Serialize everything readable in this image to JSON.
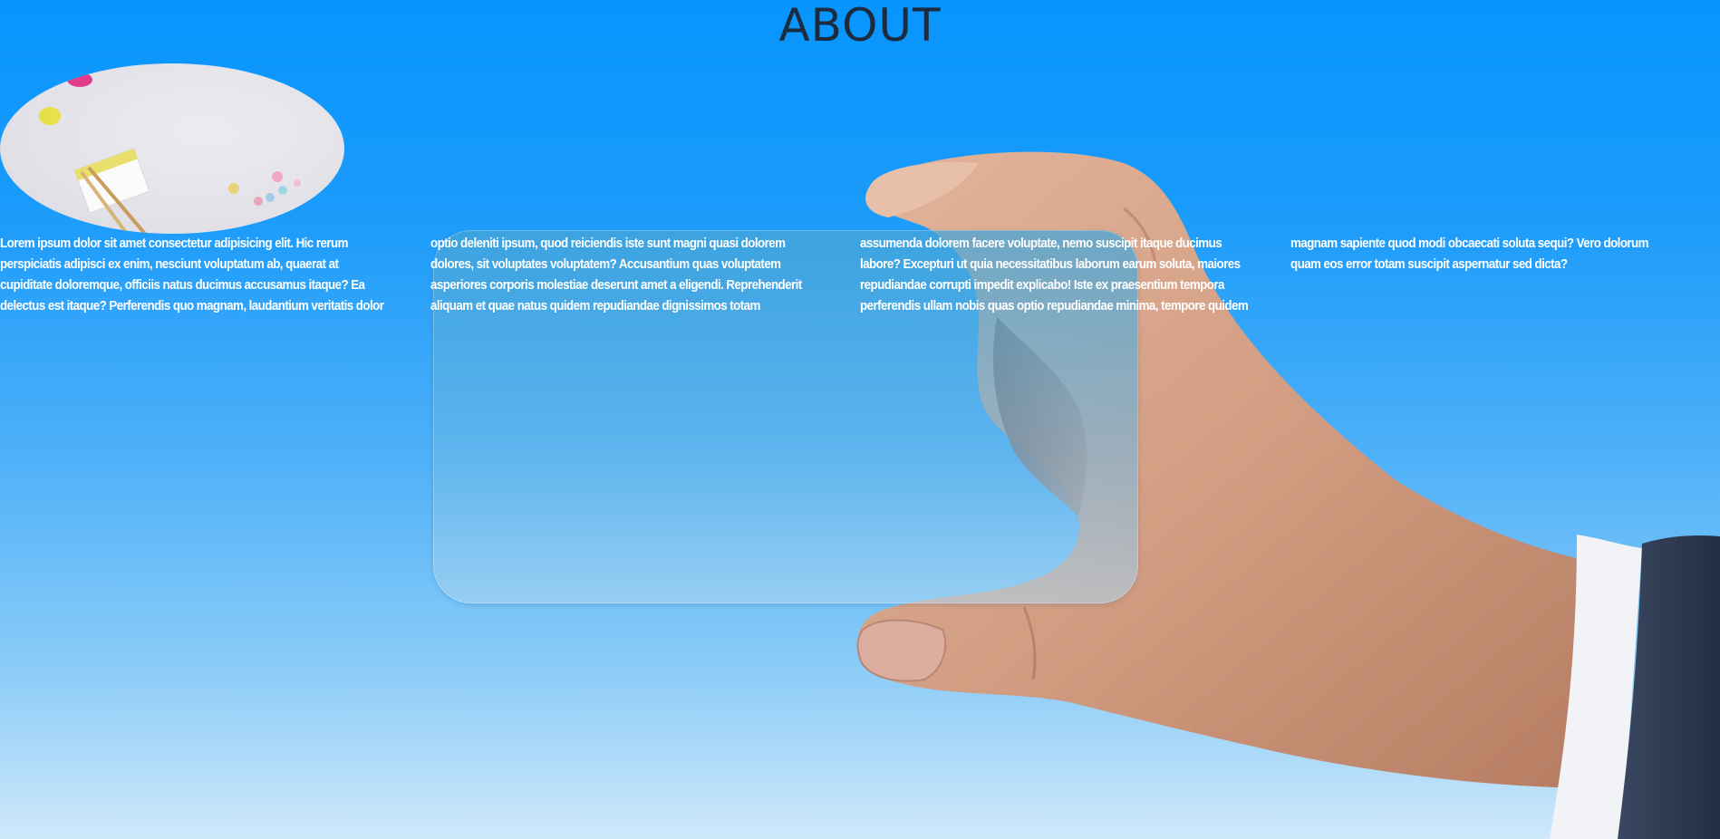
{
  "page": {
    "title": "ABOUT"
  },
  "body_text": [
    "Lorem ipsum dolor sit amet consectetur adipisicing elit. Hic rerum perspiciatis adipisci ex enim, nesciunt voluptatum ab, quaerat at cupiditate doloremque, officiis natus ducimus accusamus itaque? Ea delectus est itaque? Perferendis quo magnam, laudantium veritatis dolor",
    "optio deleniti ipsum, quod reiciendis iste sunt magni quasi dolorem dolores, sit voluptates voluptatem? Accusantium quas voluptatem asperiores corporis molestiae deserunt amet a eligendi. Reprehenderit aliquam et quae natus quidem repudiandae dignissimos totam",
    "assumenda dolorem facere voluptate, nemo suscipit itaque ducimus labore? Excepturi ut quia necessitatibus laborum earum soluta, maiores repudiandae corrupti impedit explicabo! Iste ex praesentium tempora perferendis ullam nobis quas optio repudiandae minima, tempore quidem",
    "magnam sapiente quod modi obcaecati soluta sequi? Vero dolorum quam eos error totam suscipit aspernatur sed dicta?"
  ],
  "colors": {
    "background_top": "#0795fd",
    "background_bottom": "#cfe8fb",
    "title": "#1c2b3d",
    "text": "#ffffff",
    "sleeve": "#2c3a52"
  },
  "images": {
    "hero": "desk-flatlay-image",
    "background": "hand-holding-glass-card-image"
  }
}
